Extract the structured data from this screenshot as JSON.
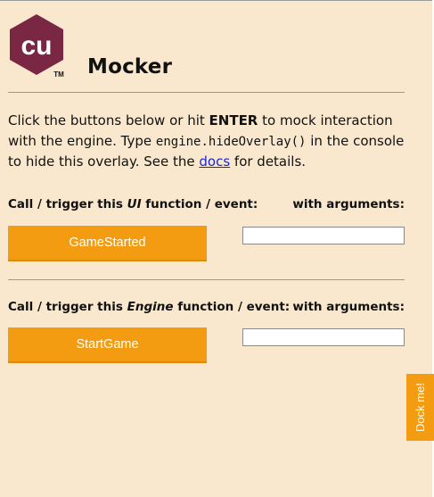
{
  "header": {
    "logo_text": "cu",
    "logo_trademark": "TM",
    "title": "Mocker"
  },
  "intro": {
    "part1": "Click the buttons below or hit ",
    "key": "ENTER",
    "part2": " to mock interaction with the engine. Type ",
    "code": "engine.hideOverlay()",
    "part3": " in the console to hide this overlay. See the ",
    "link": "docs",
    "part4": " for details."
  },
  "ui_section": {
    "label_prefix": "Call / trigger this ",
    "label_emphasis": "UI",
    "label_suffix": " function / event:",
    "args_label": "with arguments:",
    "button_label": "GameStarted",
    "args_value": ""
  },
  "engine_section": {
    "label_prefix": "Call / trigger this ",
    "label_emphasis": "Engine",
    "label_suffix": " function / event:",
    "args_label": "with arguments:",
    "button_label": "StartGame",
    "args_value": ""
  },
  "dock_button": {
    "label": "Dock me!"
  },
  "colors": {
    "background": "#f9e8cd",
    "accent": "#f39c12",
    "logo": "#7a2743",
    "link": "#1b28d4"
  }
}
